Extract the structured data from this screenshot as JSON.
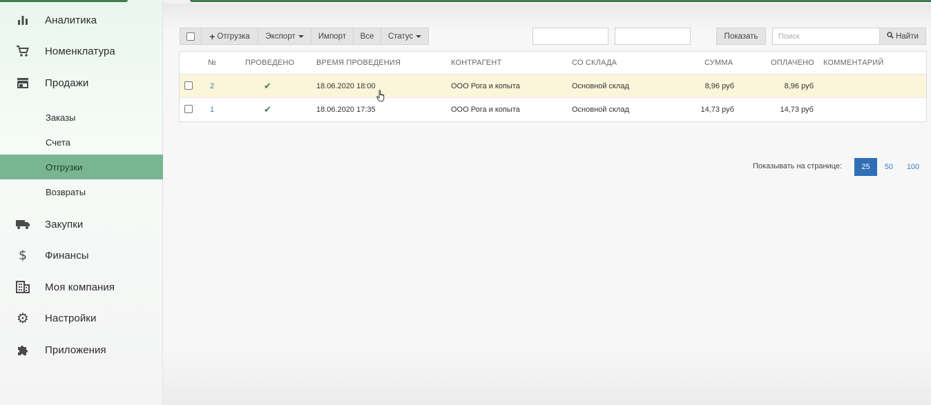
{
  "sidebar": {
    "main_items": [
      {
        "label": "Аналитика",
        "icon": "bar-chart-icon"
      },
      {
        "label": "Номенклатура",
        "icon": "cart-icon"
      },
      {
        "label": "Продажи",
        "icon": "store-icon"
      },
      {
        "label": "Закупки",
        "icon": "truck-icon"
      },
      {
        "label": "Финансы",
        "icon": "dollar-icon"
      },
      {
        "label": "Моя компания",
        "icon": "building-icon"
      },
      {
        "label": "Настройки",
        "icon": "gear-icon"
      },
      {
        "label": "Приложения",
        "icon": "puzzle-icon"
      }
    ],
    "sub_items": [
      {
        "label": "Заказы"
      },
      {
        "label": "Счета"
      },
      {
        "label": "Отгрузки",
        "active": true
      },
      {
        "label": "Возвраты"
      }
    ]
  },
  "toolbar": {
    "add_label": "Отгрузка",
    "export_label": "Экспорт",
    "import_label": "Импорт",
    "all_label": "Все",
    "status_label": "Статус",
    "date_from_value": "",
    "date_to_value": "",
    "show_label": "Показать",
    "search_placeholder": "Поиск",
    "search_button_label": "Найти"
  },
  "table": {
    "columns": [
      "№",
      "ПРОВЕДЕНО",
      "ВРЕМЯ ПРОВЕДЕНИЯ",
      "КОНТРАГЕНТ",
      "СО СКЛАДА",
      "СУММА",
      "ОПЛАЧЕНО",
      "КОММЕНТАРИЙ"
    ],
    "rows": [
      {
        "num": "2",
        "posted": "✔",
        "time": "18.06.2020 18:00",
        "counterparty": "ООО Рога и копыта",
        "warehouse": "Основной склад",
        "sum": "8,96 руб",
        "paid": "8,96 руб",
        "comment": ""
      },
      {
        "num": "1",
        "posted": "✔",
        "time": "18.06.2020 17:35",
        "counterparty": "ООО Рога и копыта",
        "warehouse": "Основной склад",
        "sum": "14,73 руб",
        "paid": "14,73 руб",
        "comment": ""
      }
    ]
  },
  "pagination": {
    "label": "Показывать на странице:",
    "options": [
      "25",
      "50",
      "100"
    ],
    "selected": "25"
  },
  "colors": {
    "accent": "#79b591",
    "brand_dark": "#3f7a50",
    "link": "#3a7dc4",
    "page_active": "#2f6fb5",
    "row_highlight": "#fbf5da"
  }
}
